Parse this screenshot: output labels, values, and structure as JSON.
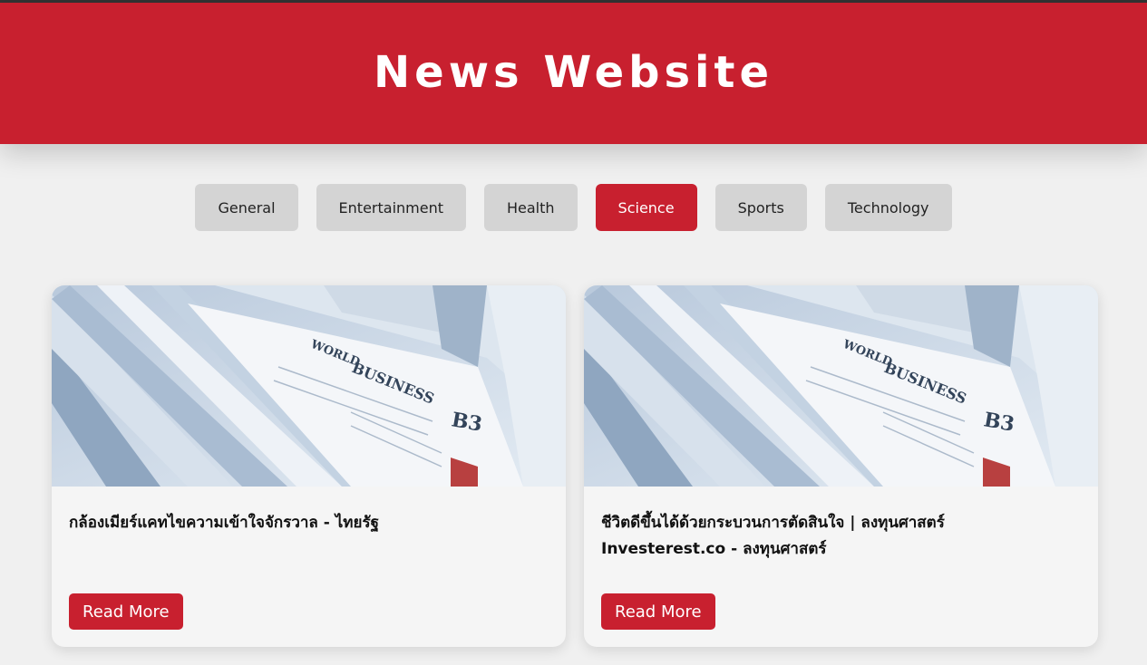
{
  "header": {
    "title": "News Website"
  },
  "categories": [
    {
      "label": "General",
      "active": false
    },
    {
      "label": "Entertainment",
      "active": false
    },
    {
      "label": "Health",
      "active": false
    },
    {
      "label": "Science",
      "active": true
    },
    {
      "label": "Sports",
      "active": false
    },
    {
      "label": "Technology",
      "active": false
    }
  ],
  "articles": [
    {
      "title": "กล้องเมียร์แคทไขความเข้าใจจักรวาล - ไทยรัฐ",
      "button_label": "Read More",
      "image": "newspaper-stack-image"
    },
    {
      "title": "ชีวิตดีขึ้นได้ด้วยกระบวนการตัดสินใจ | ลงทุนศาสตร์ Investerest.co - ลงทุนศาสตร์",
      "button_label": "Read More",
      "image": "newspaper-stack-image"
    }
  ],
  "colors": {
    "brand_red": "#c8202f",
    "page_bg": "#f0f0f0",
    "inactive_button": "#d4d4d4"
  }
}
